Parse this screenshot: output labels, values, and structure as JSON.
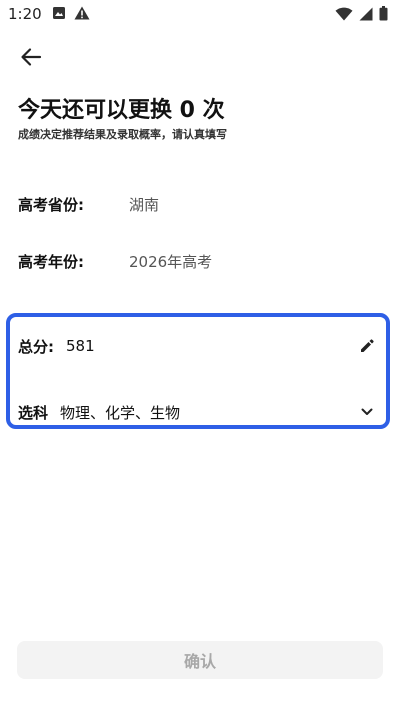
{
  "status_bar": {
    "time": "1:20",
    "left_icons": [
      "image-notification-icon",
      "warning-icon"
    ],
    "right_icons": [
      "wifi-icon",
      "signal-icon",
      "battery-icon"
    ]
  },
  "header": {
    "back_icon": "arrow-left-icon",
    "title": "今天还可以更换 0 次",
    "subtitle": "成绩决定推荐结果及录取概率，请认真填写"
  },
  "form": {
    "province": {
      "label": "高考省份:",
      "value": "湖南"
    },
    "year": {
      "label": "高考年份:",
      "value": "2026年高考"
    },
    "score": {
      "label": "总分:",
      "value": "581",
      "icon": "pencil-edit-icon"
    },
    "subjects": {
      "label": "选科",
      "value": "物理、化学、生物",
      "icon": "chevron-down-icon"
    }
  },
  "actions": {
    "confirm_label": "确认"
  },
  "colors": {
    "highlight_border": "#2e5fe6",
    "button_bg": "#f3f3f3",
    "button_text": "#a8a8a8"
  }
}
